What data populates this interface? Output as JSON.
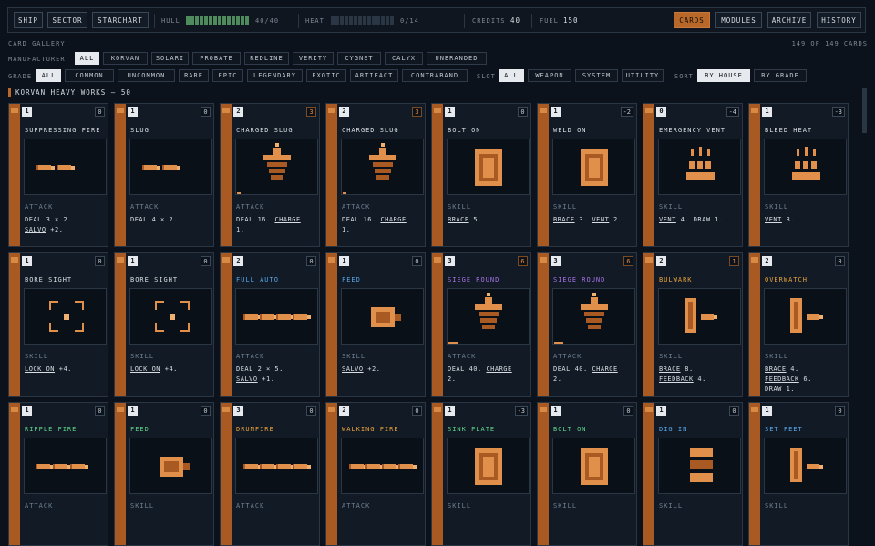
{
  "topbar": {
    "left_buttons": [
      "SHIP",
      "SECTOR",
      "STARCHART"
    ],
    "hull_label": "HULL",
    "hull_value": "40/40",
    "hull_level": 1.0,
    "heat_label": "HEAT",
    "heat_value": "0/14",
    "heat_level": 0.0,
    "credits_label": "CREDITS",
    "credits_value": "40",
    "fuel_label": "FUEL",
    "fuel_value": "150",
    "right_buttons": [
      "CARDS",
      "MODULES",
      "ARCHIVE",
      "HISTORY"
    ],
    "active_right": "CARDS"
  },
  "gallery": {
    "title": "CARD GALLERY",
    "count": "149 OF 149 CARDS"
  },
  "filters": {
    "manufacturer_label": "MANUFACTURER",
    "manufacturers": [
      "ALL",
      "KORVAN",
      "SOLARI",
      "PROBATE",
      "REDLINE",
      "VERITY",
      "CYGNET",
      "CALYX",
      "UNBRANDED"
    ],
    "grade_label": "GRADE",
    "grades": [
      "ALL",
      "COMMON",
      "UNCOMMON",
      "RARE",
      "EPIC",
      "LEGENDARY",
      "EXOTIC",
      "ARTIFACT",
      "CONTRABAND"
    ],
    "slot_label": "SLOT",
    "slots": [
      "ALL",
      "WEAPON",
      "SYSTEM",
      "UTILITY"
    ],
    "sort_label": "SORT",
    "sorts": [
      "BY HOUSE",
      "BY GRADE"
    ]
  },
  "section_header": "KORVAN HEAVY WORKS — 50",
  "colors": {
    "accent": "#b8692a",
    "common": "#d9dde2",
    "uncommon": "#5fd38a",
    "rare": "#58a6e8",
    "epic": "#a874e8",
    "legendary": "#e8a23a"
  },
  "cards": [
    {
      "cost": "1",
      "power": "0",
      "name": "SUPPRESSING FIRE",
      "rarity": "common",
      "art": "bullets2",
      "type": "ATTACK",
      "rules": [
        [
          "DEAL 3 × 2."
        ],
        [
          "",
          "SALVO",
          " +2."
        ]
      ]
    },
    {
      "cost": "1",
      "power": "0",
      "name": "SLUG",
      "rarity": "common",
      "art": "bullets2",
      "type": "ATTACK",
      "rules": [
        [
          "DEAL 4 × 2."
        ]
      ]
    },
    {
      "cost": "2",
      "power": "3",
      "name": "CHARGED SLUG",
      "rarity": "common",
      "art": "stack",
      "type": "ATTACK",
      "rules": [
        [
          "DEAL 16. ",
          "CHARGE",
          ""
        ],
        [
          "1."
        ]
      ]
    },
    {
      "cost": "2",
      "power": "3",
      "name": "CHARGED SLUG",
      "rarity": "common",
      "art": "stack",
      "type": "ATTACK",
      "rules": [
        [
          "DEAL 16. ",
          "CHARGE",
          ""
        ],
        [
          "1."
        ]
      ]
    },
    {
      "cost": "1",
      "power": "0",
      "name": "BOLT ON",
      "rarity": "common",
      "art": "plate",
      "type": "SKILL",
      "rules": [
        [
          "",
          "BRACE",
          " 5."
        ]
      ]
    },
    {
      "cost": "1",
      "power": "-2",
      "name": "WELD ON",
      "rarity": "common",
      "art": "plate",
      "type": "SKILL",
      "rules": [
        [
          "",
          "BRACE",
          " 3. ",
          "VENT",
          " 2."
        ]
      ]
    },
    {
      "cost": "0",
      "power": "-4",
      "name": "EMERGENCY VENT",
      "rarity": "common",
      "art": "vent",
      "type": "SKILL",
      "rules": [
        [
          "",
          "VENT",
          " 4. DRAW 1."
        ]
      ]
    },
    {
      "cost": "1",
      "power": "-3",
      "name": "BLEED HEAT",
      "rarity": "common",
      "art": "vent",
      "type": "SKILL",
      "rules": [
        [
          "",
          "VENT",
          " 3."
        ]
      ]
    },
    {
      "cost": "1",
      "power": "0",
      "name": "BORE SIGHT",
      "rarity": "common",
      "art": "reticle",
      "type": "SKILL",
      "rules": [
        [
          "",
          "LOCK ON",
          " +4."
        ]
      ]
    },
    {
      "cost": "1",
      "power": "0",
      "name": "BORE SIGHT",
      "rarity": "common",
      "art": "reticle",
      "type": "SKILL",
      "rules": [
        [
          "",
          "LOCK ON",
          " +4."
        ]
      ]
    },
    {
      "cost": "2",
      "power": "0",
      "name": "FULL AUTO",
      "rarity": "rare",
      "art": "bullets4",
      "type": "ATTACK",
      "rules": [
        [
          "DEAL 2 × 5."
        ],
        [
          "",
          "SALVO",
          " +1."
        ]
      ]
    },
    {
      "cost": "1",
      "power": "0",
      "name": "FEED",
      "rarity": "rare",
      "art": "feed",
      "type": "SKILL",
      "rules": [
        [
          "",
          "SALVO",
          " +2."
        ]
      ]
    },
    {
      "cost": "3",
      "power": "6",
      "name": "SIEGE ROUND",
      "rarity": "epic",
      "art": "stack",
      "type": "ATTACK",
      "rules": [
        [
          "DEAL 40. ",
          "CHARGE",
          ""
        ],
        [
          "2."
        ]
      ]
    },
    {
      "cost": "3",
      "power": "6",
      "name": "SIEGE ROUND",
      "rarity": "epic",
      "art": "stack",
      "type": "ATTACK",
      "rules": [
        [
          "DEAL 40. ",
          "CHARGE",
          ""
        ],
        [
          "2."
        ]
      ]
    },
    {
      "cost": "2",
      "power": "1",
      "name": "BULWARK",
      "rarity": "legendary",
      "art": "post",
      "type": "SKILL",
      "rules": [
        [
          "",
          "BRACE",
          " 8."
        ],
        [
          "",
          "FEEDBACK",
          " 4."
        ]
      ]
    },
    {
      "cost": "2",
      "power": "0",
      "name": "OVERWATCH",
      "rarity": "legendary",
      "art": "post",
      "type": "SKILL",
      "rules": [
        [
          "",
          "BRACE",
          " 4."
        ],
        [
          "",
          "FEEDBACK",
          " 6."
        ],
        [
          "DRAW 1."
        ]
      ]
    },
    {
      "cost": "1",
      "power": "0",
      "name": "RIPPLE FIRE",
      "rarity": "uncommon",
      "art": "bullets3",
      "type": "ATTACK",
      "rules": []
    },
    {
      "cost": "1",
      "power": "0",
      "name": "FEED",
      "rarity": "uncommon",
      "art": "feed",
      "type": "SKILL",
      "rules": []
    },
    {
      "cost": "3",
      "power": "0",
      "name": "DRUMFIRE",
      "rarity": "legendary",
      "art": "bullets4",
      "type": "ATTACK",
      "rules": []
    },
    {
      "cost": "2",
      "power": "0",
      "name": "WALKING FIRE",
      "rarity": "legendary",
      "art": "bullets4",
      "type": "ATTACK",
      "rules": []
    },
    {
      "cost": "1",
      "power": "-3",
      "name": "SINK PLATE",
      "rarity": "uncommon",
      "art": "plate",
      "type": "SKILL",
      "rules": []
    },
    {
      "cost": "1",
      "power": "0",
      "name": "BOLT ON",
      "rarity": "uncommon",
      "art": "plate",
      "type": "SKILL",
      "rules": []
    },
    {
      "cost": "1",
      "power": "0",
      "name": "DIG IN",
      "rarity": "rare",
      "art": "bars",
      "type": "SKILL",
      "rules": []
    },
    {
      "cost": "1",
      "power": "0",
      "name": "SET FEET",
      "rarity": "rare",
      "art": "post",
      "type": "SKILL",
      "rules": []
    }
  ]
}
